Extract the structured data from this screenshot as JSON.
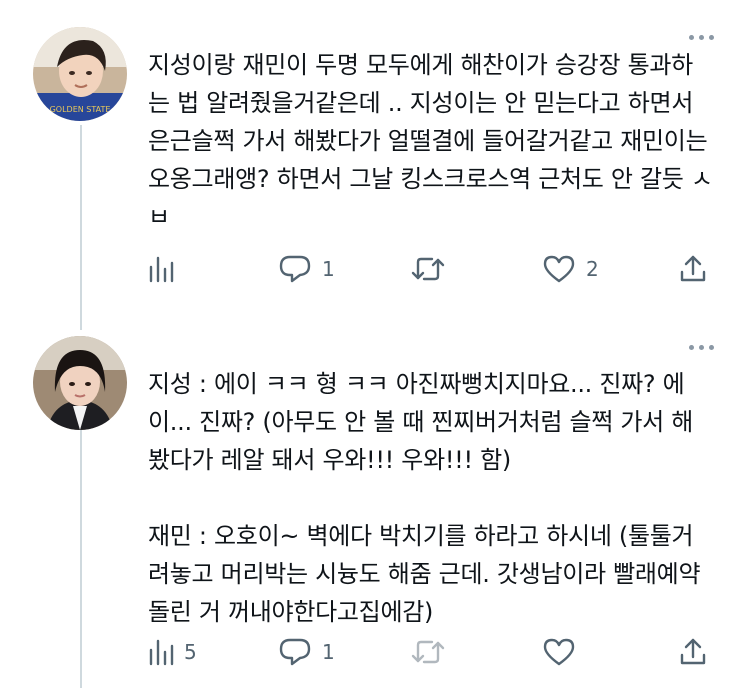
{
  "colors": {
    "icon": "#536471",
    "thread_line": "#cfd9de",
    "text": "#0f1419"
  },
  "tweets": [
    {
      "text": "지성이랑 재민이 두명 모두에게 해찬이가 승강장 통과하는 법 알려줬을거같은데 .. 지성이는 안 믿는다고 하면서 은근슬쩍 가서 해봤다가 얼떨결에 들어갈거같고 재민이는 오옹그래앵? 하면서 그날 킹스크로스역 근처도 안 갈듯 ㅅㅂ",
      "stats": {
        "views": "",
        "replies": "1",
        "retweets": "",
        "likes": "2"
      },
      "icons": [
        "views-icon",
        "reply-icon",
        "retweet-icon",
        "like-icon",
        "share-icon"
      ]
    },
    {
      "text": "지성 : 에이 ㅋㅋ 형 ㅋㅋ 아진짜뻥치지마요... 진짜? 에이... 진짜? (아무도 안 볼 때 찐찌버거처럼 슬쩍 가서 해봤다가 레알 돼서 우와!!! 우와!!! 함)\n\n재민 : 오호이~ 벽에다 박치기를 하라고 하시네 (툴툴거려놓고 머리박는 시늉도 해줌 근데. 갓생남이라 빨래예약돌린 거 꺼내야한다고집에감)",
      "stats": {
        "views": "5",
        "replies": "1",
        "retweets": "",
        "likes": ""
      },
      "icons": [
        "views-icon",
        "reply-icon",
        "retweet-icon",
        "like-icon",
        "share-icon"
      ]
    }
  ]
}
